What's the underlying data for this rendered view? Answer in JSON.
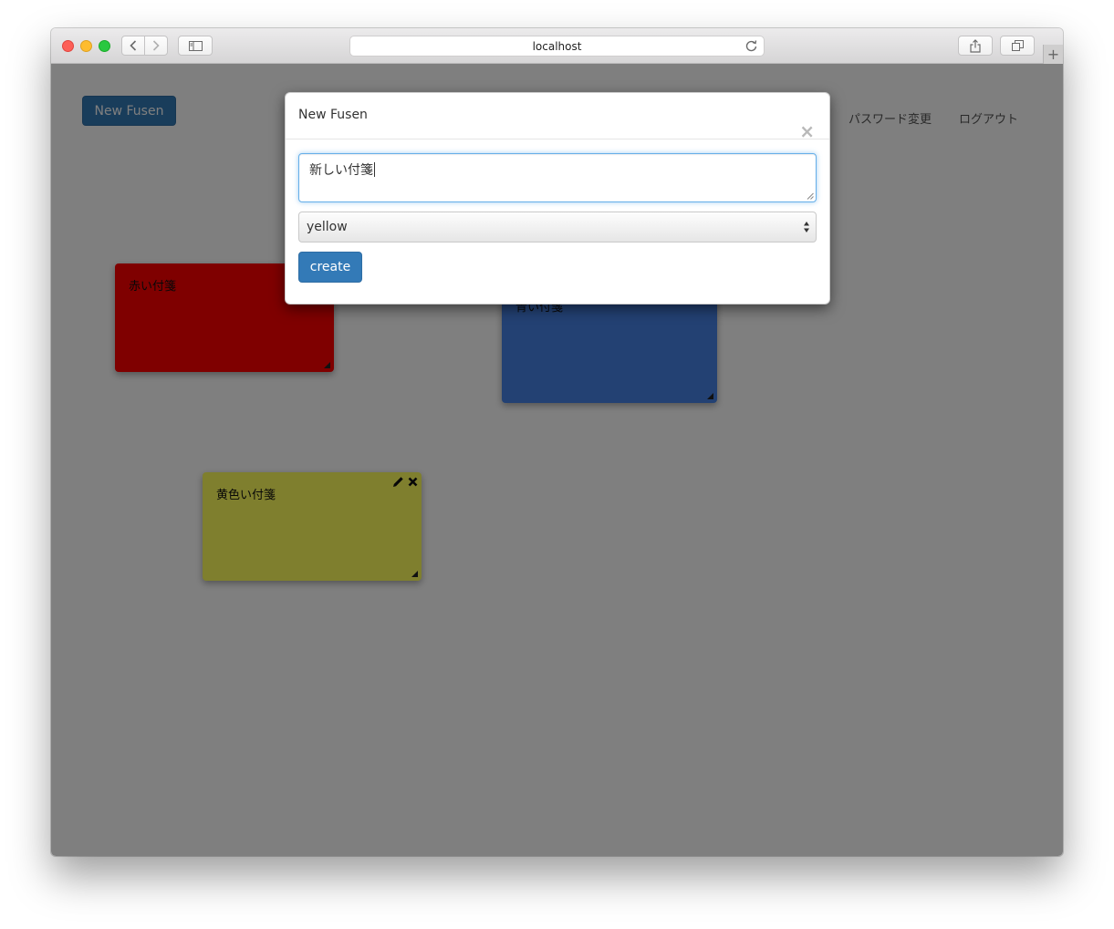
{
  "browser": {
    "url": "localhost",
    "plus_label": "+"
  },
  "header": {
    "new_button_label": "New Fusen",
    "links": [
      "パスワード変更",
      "ログアウト"
    ]
  },
  "notes": [
    {
      "text": "赤い付箋",
      "color": "#ff0000"
    },
    {
      "text": "青い付箋",
      "color": "#4682e6"
    },
    {
      "text": "黄色い付箋",
      "color": "#ffff5c"
    }
  ],
  "modal": {
    "title": "New Fusen",
    "close_label": "×",
    "textarea_value": "新しい付箋",
    "select_value": "yellow",
    "submit_label": "create"
  },
  "colors": {
    "primary": "#337ab7",
    "focus_border": "#66afe9",
    "overlay": "rgba(0,0,0,0.5)"
  }
}
